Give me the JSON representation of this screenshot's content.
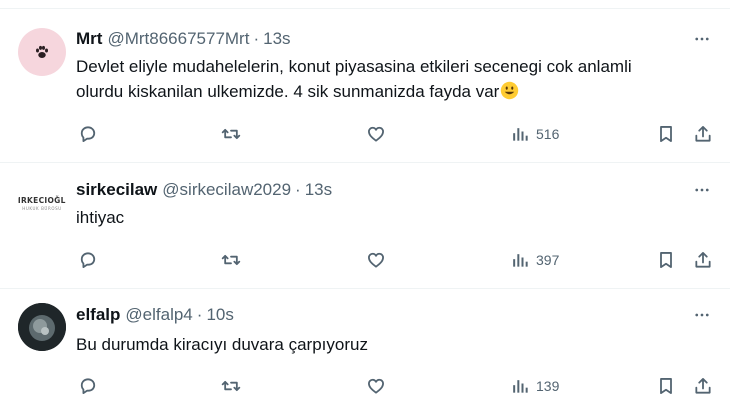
{
  "tweets": [
    {
      "name": "Mrt",
      "handle": "@Mrt86667577Mrt",
      "separator": "·",
      "time": "13s",
      "text_lines": [
        "Devlet eliyle mudahelelerin, konut piyasasina etkileri secenegi cok anlamli",
        "olurdu kiskanilan ulkemizde. 4 sik sunmanizda fayda var"
      ],
      "views": "516",
      "avatar_icon": "paw-icon"
    },
    {
      "name": "sirkecilaw",
      "handle": "@sirkecilaw2029",
      "separator": "·",
      "time": "13s",
      "text_lines": [
        "ihtiyac"
      ],
      "views": "397",
      "avatar_logo": {
        "line1": "SIRKECIOĞLU",
        "line2": "HUKUK BÜROSU"
      }
    },
    {
      "name": "elfalp",
      "handle": "@elfalp4",
      "separator": "·",
      "time": "10s",
      "text_lines": [
        "Bu durumda kiracıyı duvara çarpıyoruz"
      ],
      "views": "139"
    }
  ],
  "colors": {
    "text": "#0f1419",
    "secondary": "#536471",
    "divider": "#eff3f4",
    "avatar_pink": "#f6d6dd",
    "emoji_yellow": "#ffcc33"
  },
  "icons": [
    "reply-icon",
    "retweet-icon",
    "like-icon",
    "views-icon",
    "bookmark-icon",
    "share-icon",
    "more-icon",
    "smile-emoji-icon"
  ]
}
